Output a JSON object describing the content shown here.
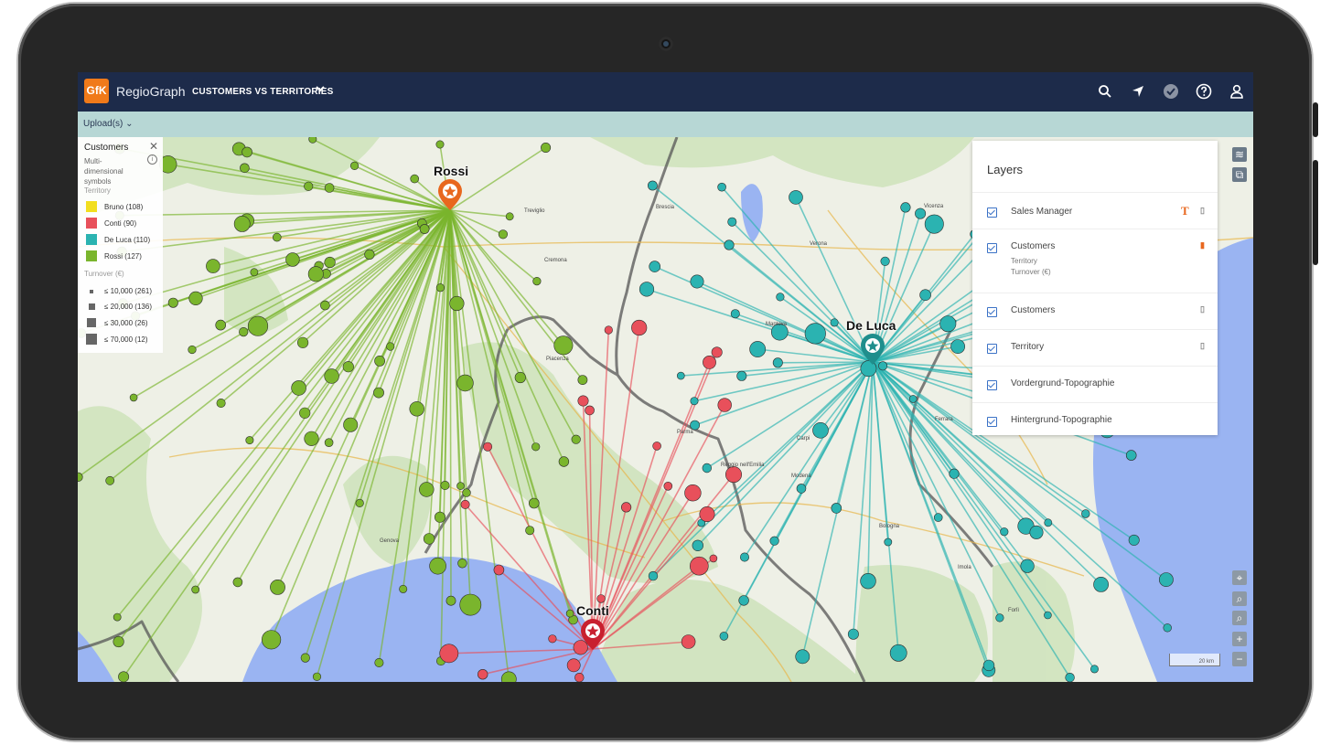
{
  "app": {
    "logo": "GfK",
    "name": "RegioGraph",
    "project": "CUSTOMERS VS TERRITORIES",
    "upload_menu": "Upload(s)"
  },
  "toolbar_icons": [
    "search-icon",
    "locate-icon",
    "status-check-icon",
    "help-icon",
    "user-icon"
  ],
  "legend": {
    "title": "Customers",
    "subtitle": "Multi-dimensional symbols",
    "territory_label": "Territory",
    "territories": [
      {
        "label": "Bruno (108)",
        "color": "#f2de1e"
      },
      {
        "label": "Conti (90)",
        "color": "#e8505b"
      },
      {
        "label": "De Luca (110)",
        "color": "#2bb3b1"
      },
      {
        "label": "Rossi (127)",
        "color": "#7ab52d"
      }
    ],
    "turnover_label": "Turnover (€)",
    "turnover": [
      {
        "label": "≤ 10,000 (261)"
      },
      {
        "label": "≤ 20,000 (136)"
      },
      {
        "label": "≤ 30,000 (26)"
      },
      {
        "label": "≤ 70,000 (12)"
      }
    ]
  },
  "layers": {
    "title": "Layers",
    "items": [
      {
        "name": "Sales Manager",
        "checked": true,
        "sub": []
      },
      {
        "name": "Customers",
        "checked": true,
        "sub": [
          "Territory",
          "Turnover (€)"
        ]
      },
      {
        "name": "Customers",
        "checked": true,
        "sub": []
      },
      {
        "name": "Territory",
        "checked": true,
        "sub": []
      },
      {
        "name": "Vordergrund-Topographie",
        "checked": true,
        "sub": []
      },
      {
        "name": "Hintergrund-Topographie",
        "checked": true,
        "sub": []
      }
    ]
  },
  "managers": [
    {
      "name": "Rossi",
      "color": "#e8671e"
    },
    {
      "name": "De Luca",
      "color": "#1f8e8c"
    },
    {
      "name": "Conti",
      "color": "#c8202f"
    }
  ],
  "map_labels": {
    "cities": [
      "Brescia",
      "Verona",
      "Vicenza",
      "Cremona",
      "Piacenza",
      "Parma",
      "Reggio nell'Emilia",
      "Modena",
      "Bologna",
      "Ferrara",
      "Genova",
      "Imola",
      "Forlì",
      "Treviglio",
      "Mantova",
      "Carpi"
    ],
    "scale": "20 km"
  },
  "colors": {
    "topbar": "#1d2b4a",
    "subbar": "#b7d7d5",
    "sea": "#9ab4f2",
    "land": "#eef0e6",
    "forest": "#c9dfb7",
    "accent": "#f07a1a"
  }
}
